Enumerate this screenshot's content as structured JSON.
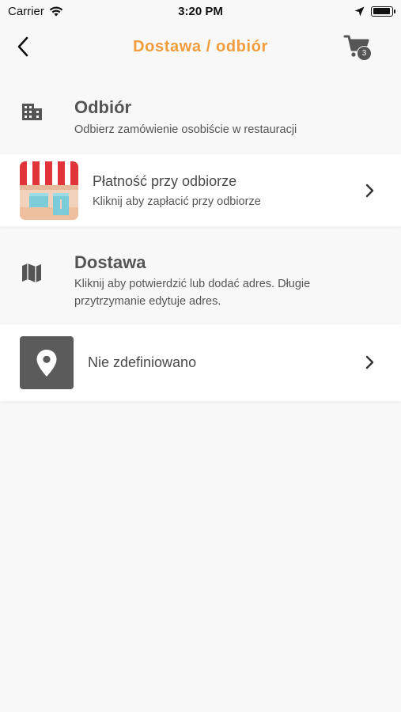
{
  "status_bar": {
    "carrier": "Carrier",
    "time": "3:20 PM",
    "battery_level": 0.95
  },
  "nav": {
    "title": "Dostawa / odbiór",
    "title_color": "#f39c3c",
    "back_icon": "chevron-left-icon",
    "cart_icon": "cart-icon",
    "cart_count": "3"
  },
  "pickup": {
    "icon": "building-icon",
    "title": "Odbiór",
    "description": "Odbierz zamówienie osobiście w restauracji",
    "payment_row": {
      "icon": "shop-storefront-icon",
      "title": "Płatność przy odbiorze",
      "subtitle": "Kliknij aby zapłacić przy odbiorze"
    }
  },
  "delivery": {
    "icon": "map-icon",
    "title": "Dostawa",
    "description": "Kliknij aby potwierdzić lub dodać adres. Długie przytrzymanie edytuje adres.",
    "address_row": {
      "icon": "location-pin-icon",
      "title": "Nie zdefiniowano"
    }
  }
}
